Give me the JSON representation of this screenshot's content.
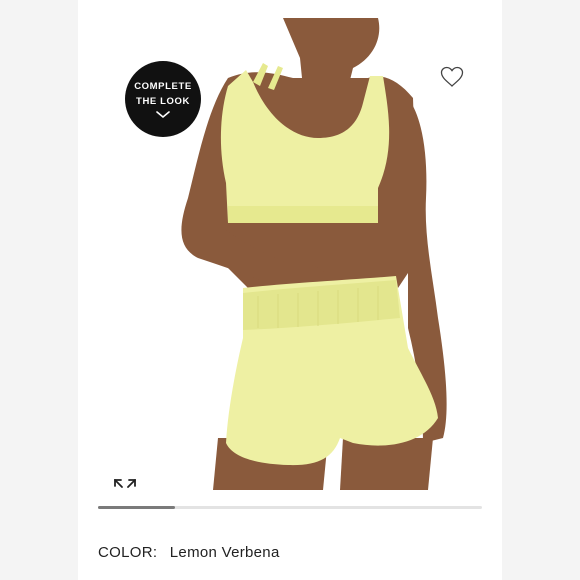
{
  "complete_look": {
    "line1": "COMPLETE",
    "line2": "THE LOOK"
  },
  "icons": {
    "favorite": "heart-icon",
    "expand": "expand-icon",
    "chevron": "chevron-down-icon"
  },
  "gallery": {
    "progress_fraction": 0.2
  },
  "color_selector": {
    "label": "COLOR:",
    "value": "Lemon Verbena"
  },
  "colors": {
    "garment": "#eef0a3",
    "badge": "#111111"
  }
}
